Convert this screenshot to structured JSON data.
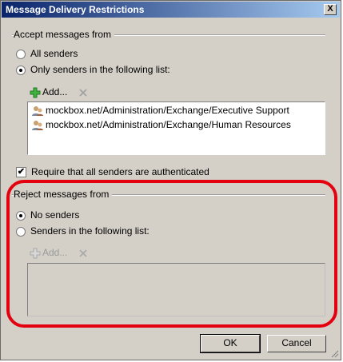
{
  "window": {
    "title": "Message Delivery Restrictions",
    "close_label": "X"
  },
  "accept": {
    "group_label": "Accept messages from",
    "all_senders": "All senders",
    "only_senders": "Only senders in the following list:",
    "add_label": "Add...",
    "list": [
      "mockbox.net/Administration/Exchange/Executive Support",
      "mockbox.net/Administration/Exchange/Human Resources"
    ],
    "require_auth": "Require that all senders are authenticated",
    "require_auth_checked": true,
    "selected": "only_senders"
  },
  "reject": {
    "group_label": "Reject messages from",
    "no_senders": "No senders",
    "senders_list": "Senders in the following list:",
    "add_label": "Add...",
    "selected": "no_senders"
  },
  "buttons": {
    "ok": "OK",
    "cancel": "Cancel"
  }
}
